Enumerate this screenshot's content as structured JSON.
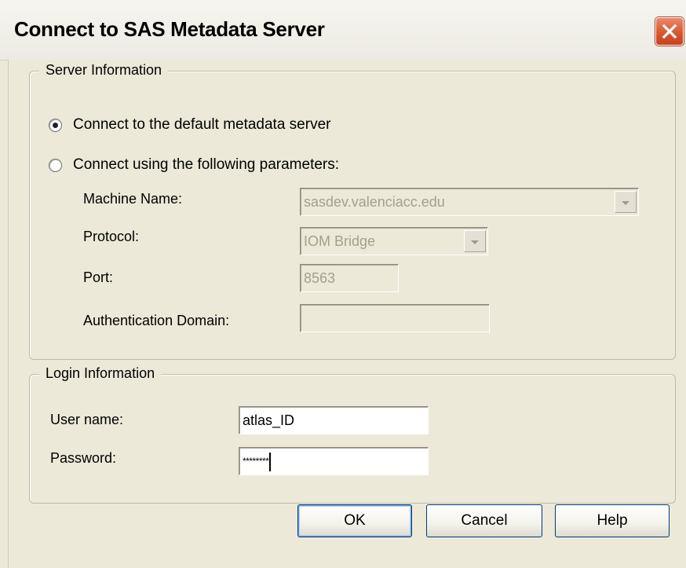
{
  "window": {
    "title": "Connect to SAS Metadata Server",
    "close_icon": "close-icon"
  },
  "server_info": {
    "legend": "Server Information",
    "radio_default": {
      "label": "Connect to the default metadata server",
      "selected": true
    },
    "radio_params": {
      "label": "Connect using the following parameters:",
      "selected": false
    },
    "machine_name": {
      "label": "Machine Name:",
      "value": "sasdev.valenciacc.edu",
      "enabled": false
    },
    "protocol": {
      "label": "Protocol:",
      "value": "IOM Bridge",
      "enabled": false
    },
    "port": {
      "label": "Port:",
      "value": "8563",
      "enabled": false
    },
    "auth_domain": {
      "label": "Authentication Domain:",
      "value": "",
      "enabled": false
    }
  },
  "login_info": {
    "legend": "Login Information",
    "username": {
      "label": "User name:",
      "value": "atlas_ID"
    },
    "password": {
      "label": "Password:",
      "value": "********"
    }
  },
  "buttons": {
    "ok": "OK",
    "cancel": "Cancel",
    "help": "Help"
  },
  "colors": {
    "dialog_bg": "#ece9d8",
    "close_button": "#d9572f",
    "default_button_focus": "#7ba2e7"
  }
}
